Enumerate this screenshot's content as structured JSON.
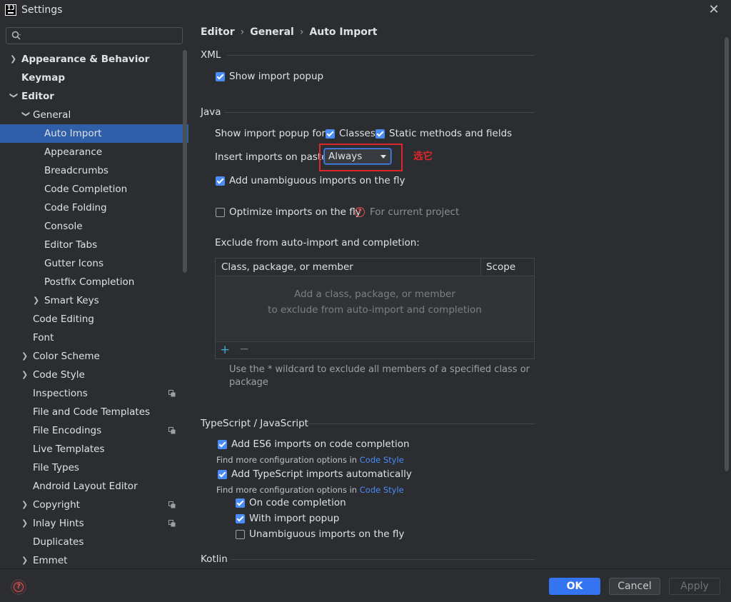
{
  "window": {
    "title": "Settings",
    "close": "✕"
  },
  "search": {
    "placeholder": ""
  },
  "sidebar": {
    "items": [
      {
        "label": "Appearance & Behavior"
      },
      {
        "label": "Keymap"
      },
      {
        "label": "Editor"
      },
      {
        "label": "General"
      },
      {
        "label": "Auto Import"
      },
      {
        "label": "Appearance"
      },
      {
        "label": "Breadcrumbs"
      },
      {
        "label": "Code Completion"
      },
      {
        "label": "Code Folding"
      },
      {
        "label": "Console"
      },
      {
        "label": "Editor Tabs"
      },
      {
        "label": "Gutter Icons"
      },
      {
        "label": "Postfix Completion"
      },
      {
        "label": "Smart Keys"
      },
      {
        "label": "Code Editing"
      },
      {
        "label": "Font"
      },
      {
        "label": "Color Scheme"
      },
      {
        "label": "Code Style"
      },
      {
        "label": "Inspections"
      },
      {
        "label": "File and Code Templates"
      },
      {
        "label": "File Encodings"
      },
      {
        "label": "Live Templates"
      },
      {
        "label": "File Types"
      },
      {
        "label": "Android Layout Editor"
      },
      {
        "label": "Copyright"
      },
      {
        "label": "Inlay Hints"
      },
      {
        "label": "Duplicates"
      },
      {
        "label": "Emmet"
      }
    ]
  },
  "breadcrumb": {
    "part1": "Editor",
    "sep": "›",
    "part2": "General",
    "part3": "Auto Import"
  },
  "xml": {
    "title": "XML",
    "show_popup": "Show import popup"
  },
  "java": {
    "title": "Java",
    "show_popup_for": "Show import popup for:",
    "classes": "Classes",
    "static_methods": "Static methods and fields",
    "insert_on_paste": "Insert imports on paste:",
    "paste_value": "Always",
    "annotation": "选它",
    "add_unambiguous": "Add unambiguous imports on the fly",
    "optimize": "Optimize imports on the fly",
    "for_current_project": "For current project",
    "exclude_label": "Exclude from auto-import and completion:",
    "table": {
      "col1": "Class, package, or member",
      "col2": "Scope",
      "empty1": "Add a class, package, or member",
      "empty2": "to exclude from auto-import and completion",
      "add": "+",
      "remove": "−"
    },
    "hint1": "Use the * wildcard to exclude all members of a specified class or",
    "hint2": "package"
  },
  "ts": {
    "title": "TypeScript / JavaScript",
    "es6": "Add ES6 imports on code completion",
    "find_more": "Find more configuration options in ",
    "code_style": "Code Style",
    "ts_auto": "Add TypeScript imports automatically",
    "on_completion": "On code completion",
    "with_popup": "With import popup",
    "unambiguous": "Unambiguous imports on the fly"
  },
  "kotlin": {
    "title": "Kotlin"
  },
  "footer": {
    "help": "?",
    "ok": "OK",
    "cancel": "Cancel",
    "apply": "Apply"
  },
  "colors": {
    "accent": "#3574f0",
    "selection": "#2e5fa8",
    "annotation": "#e0262a",
    "link": "#4a8cf7"
  }
}
